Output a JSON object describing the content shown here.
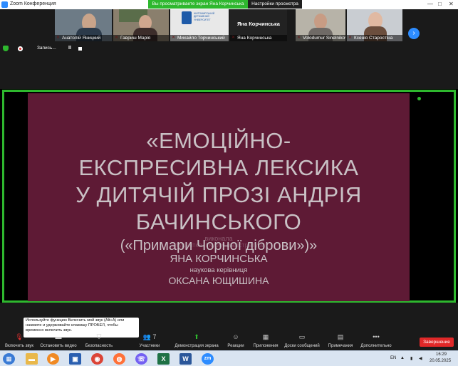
{
  "window": {
    "title": "Zoom Конференция",
    "controls": [
      "—",
      "□",
      "✕"
    ]
  },
  "share_banner": "Вы просматриваете экран Яна Корчинська",
  "view_options": "Настройки просмотра",
  "participants": [
    {
      "name": "Анатолій Яницкий"
    },
    {
      "name": "Гавриш Марія"
    },
    {
      "name": "Михайло Торчинський"
    },
    {
      "name": "Яна Корчинська",
      "big_name": "Яна Корчинська"
    },
    {
      "name": "Volodumur Sinelnikov"
    },
    {
      "name": "Ксенія Старостіна"
    }
  ],
  "university_logo_text": "ЖИТОМИРСЬКИЙ ДЕРЖАВНИЙ УНІВЕРСИТЕТ",
  "next_icon": "chevron-right-icon",
  "recording": {
    "label": "Запись...",
    "pause": "II"
  },
  "slide": {
    "title_lines": [
      "«ЕМОЦІЙНО-",
      "ЕКСПРЕСИВНА ЛЕКСИКА",
      "У ДИТЯЧІЙ ПРОЗІ АНДРІЯ",
      "БАЧИНСЬКОГО"
    ],
    "performed_label": "виконала",
    "hidden_line": "студентка ІІ курсу магістратури",
    "book_title": "(«Примари Чорної діброви»)»",
    "author": "ЯНА КОРЧИНСЬКА",
    "supervisor_label": "наукова керівниця",
    "supervisor": "ОКСАНА ЮЩИШИНА"
  },
  "tooltip": {
    "text": "Используйте функцию Включить мой звук (Alt+A) или нажмите и удерживайте клавишу ПРОБЕЛ, чтобы временно включить звук."
  },
  "toolbar": {
    "unmute": "Включить звук",
    "stop_video": "Остановить видео",
    "security": "Безопасность",
    "participants": "Участники",
    "participants_count": "7",
    "share": "Демонстрация экрана",
    "reactions": "Реакции",
    "apps": "Приложения",
    "whiteboards": "Доски сообщений",
    "notes": "Примечания",
    "more": "Дополнительно",
    "end": "Завершение"
  },
  "taskbar": {
    "lang": "EN",
    "time": "16:29",
    "date": "20.05.2025",
    "apps": [
      "start",
      "explorer",
      "media",
      "file-manager",
      "chrome",
      "firefox",
      "viber",
      "excel",
      "word",
      "zoom"
    ]
  },
  "colors": {
    "share_green": "#2eb82e",
    "slide_bg": "#5e1a35",
    "end_red": "#e02828",
    "zoom_blue": "#2d8cff"
  }
}
